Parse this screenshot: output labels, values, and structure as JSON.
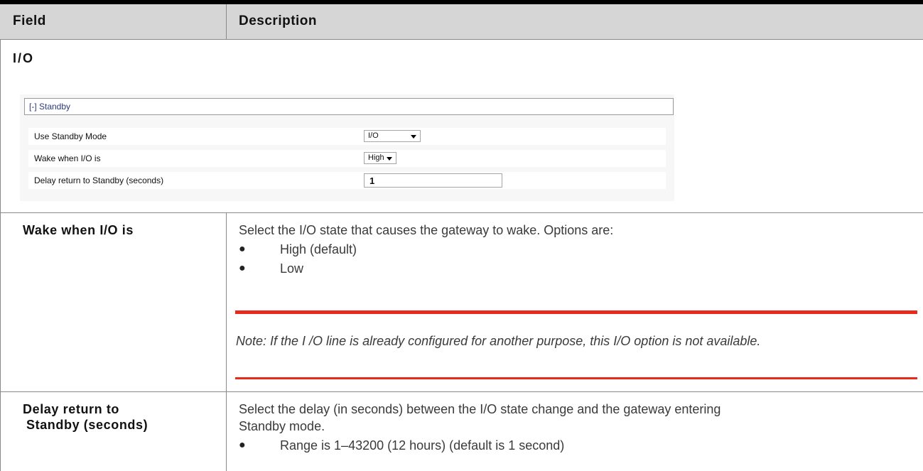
{
  "table": {
    "headers": {
      "field": "Field",
      "description": "Description"
    },
    "section_title": "I/O"
  },
  "screenshot": {
    "panel_title": "[-] Standby",
    "rows": [
      {
        "label": "Use Standby Mode",
        "control": "select",
        "value": "I/O"
      },
      {
        "label": "Wake when I/O is",
        "control": "select",
        "value": "High"
      },
      {
        "label": "Delay return to Standby (seconds)",
        "control": "input",
        "value": "1"
      }
    ]
  },
  "rows": [
    {
      "field": "Wake when I/O is",
      "description": "Select the I/O state that causes the gateway to wake. Options are:",
      "bullets": [
        "High (default)",
        "Low"
      ],
      "note": "Note:  If the I /O line is already configured for another purpose, this I/O option is not available."
    },
    {
      "field_line1": "Delay return to",
      "field_line2": "Standby (seconds)",
      "description_line1": "Select the delay (in seconds) between the I/O state change and the gateway entering",
      "description_line2": "Standby mode.",
      "bullets": [
        "Range is 1–43200 (12 hours) (default is 1 second)"
      ]
    }
  ],
  "colors": {
    "note_rule": "#e8291c",
    "header_bg": "#d6d6d6"
  }
}
